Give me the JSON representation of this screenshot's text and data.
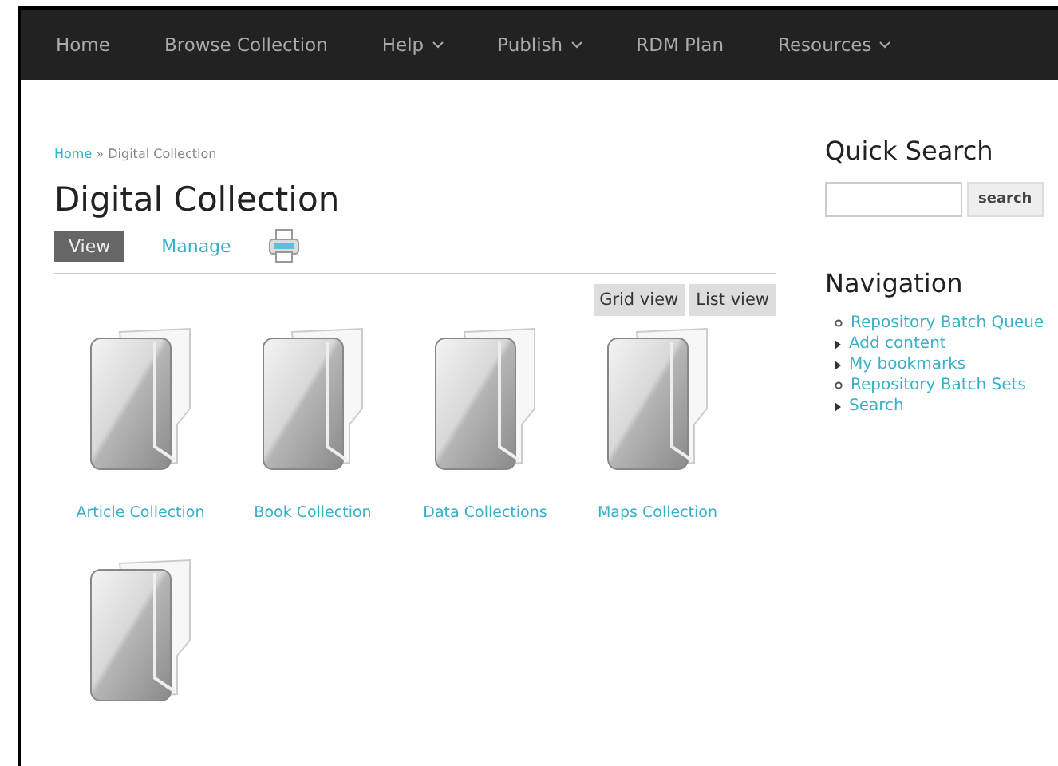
{
  "top_nav": [
    {
      "label": "Home",
      "dropdown": false
    },
    {
      "label": "Browse Collection",
      "dropdown": false
    },
    {
      "label": "Help",
      "dropdown": true
    },
    {
      "label": "Publish",
      "dropdown": true
    },
    {
      "label": "RDM Plan",
      "dropdown": false
    },
    {
      "label": "Resources",
      "dropdown": true
    }
  ],
  "breadcrumb": {
    "link": "Home",
    "separator": "»",
    "current": "Digital Collection"
  },
  "title": "Digital Collection",
  "tabs": [
    {
      "label": "View",
      "selected": true
    },
    {
      "label": "Manage",
      "selected": false
    }
  ],
  "view_buttons": [
    "Grid view",
    "List view"
  ],
  "collections": [
    {
      "kind": "folder",
      "label": "Article Collection"
    },
    {
      "kind": "folder",
      "label": "Book Collection"
    },
    {
      "kind": "folder",
      "label": "Data Collections"
    },
    {
      "kind": "folder",
      "label": "Maps Collection"
    },
    {
      "kind": "folder"
    }
  ],
  "quick_search": {
    "heading": "Quick Search",
    "button": "search"
  },
  "navigation": {
    "heading": "Navigation",
    "items": [
      {
        "label": "Repository Batch Queue",
        "kind": "leaf"
      },
      {
        "label": "Add content",
        "kind": "collapsed"
      },
      {
        "label": "My bookmarks",
        "kind": "collapsed"
      },
      {
        "label": "Repository Batch Sets",
        "kind": "leaf"
      },
      {
        "label": "Search",
        "kind": "collapsed"
      }
    ]
  }
}
